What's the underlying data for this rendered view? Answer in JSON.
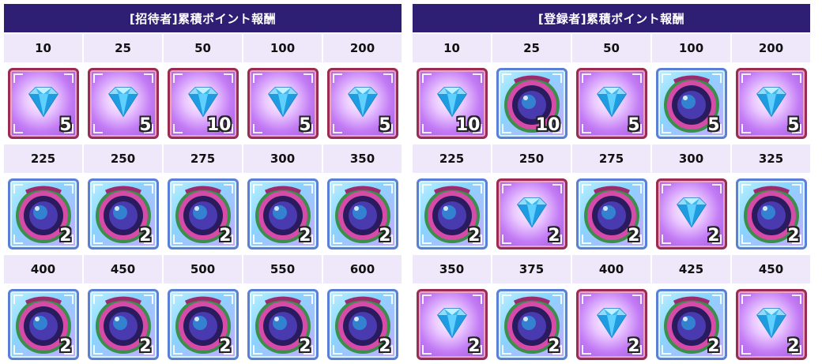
{
  "panels": [
    {
      "title": "[招待者]累積ポイント報酬",
      "rows": [
        {
          "points": [
            "10",
            "25",
            "50",
            "100",
            "200"
          ],
          "items": [
            {
              "type": "gem",
              "qty": "5"
            },
            {
              "type": "gem",
              "qty": "5"
            },
            {
              "type": "gem",
              "qty": "10"
            },
            {
              "type": "gem",
              "qty": "5"
            },
            {
              "type": "gem",
              "qty": "5"
            }
          ]
        },
        {
          "points": [
            "225",
            "250",
            "275",
            "300",
            "350"
          ],
          "items": [
            {
              "type": "orb",
              "qty": "2"
            },
            {
              "type": "orb",
              "qty": "2"
            },
            {
              "type": "orb",
              "qty": "2"
            },
            {
              "type": "orb",
              "qty": "2"
            },
            {
              "type": "orb",
              "qty": "2"
            }
          ]
        },
        {
          "points": [
            "400",
            "450",
            "500",
            "550",
            "600"
          ],
          "items": [
            {
              "type": "orb",
              "qty": "2"
            },
            {
              "type": "orb",
              "qty": "2"
            },
            {
              "type": "orb",
              "qty": "2"
            },
            {
              "type": "orb",
              "qty": "2"
            },
            {
              "type": "orb",
              "qty": "2"
            }
          ]
        }
      ]
    },
    {
      "title": "[登録者]累積ポイント報酬",
      "rows": [
        {
          "points": [
            "10",
            "25",
            "50",
            "100",
            "200"
          ],
          "items": [
            {
              "type": "gem",
              "qty": "10"
            },
            {
              "type": "orb",
              "qty": "10"
            },
            {
              "type": "gem",
              "qty": "5"
            },
            {
              "type": "orb",
              "qty": "5"
            },
            {
              "type": "gem",
              "qty": "5"
            }
          ]
        },
        {
          "points": [
            "225",
            "250",
            "275",
            "300",
            "325"
          ],
          "items": [
            {
              "type": "orb",
              "qty": "2"
            },
            {
              "type": "gem",
              "qty": "2"
            },
            {
              "type": "orb",
              "qty": "2"
            },
            {
              "type": "gem",
              "qty": "2"
            },
            {
              "type": "orb",
              "qty": "2"
            }
          ]
        },
        {
          "points": [
            "350",
            "375",
            "400",
            "425",
            "450"
          ],
          "items": [
            {
              "type": "gem",
              "qty": "2"
            },
            {
              "type": "orb",
              "qty": "2"
            },
            {
              "type": "gem",
              "qty": "2"
            },
            {
              "type": "orb",
              "qty": "2"
            },
            {
              "type": "gem",
              "qty": "2"
            }
          ]
        }
      ]
    }
  ],
  "icons": {
    "gem": "blue-diamond-gem-icon",
    "orb": "ornate-purple-orb-icon"
  },
  "colors": {
    "header_bg": "#2e1e74",
    "points_bg": "#efe8fb"
  }
}
